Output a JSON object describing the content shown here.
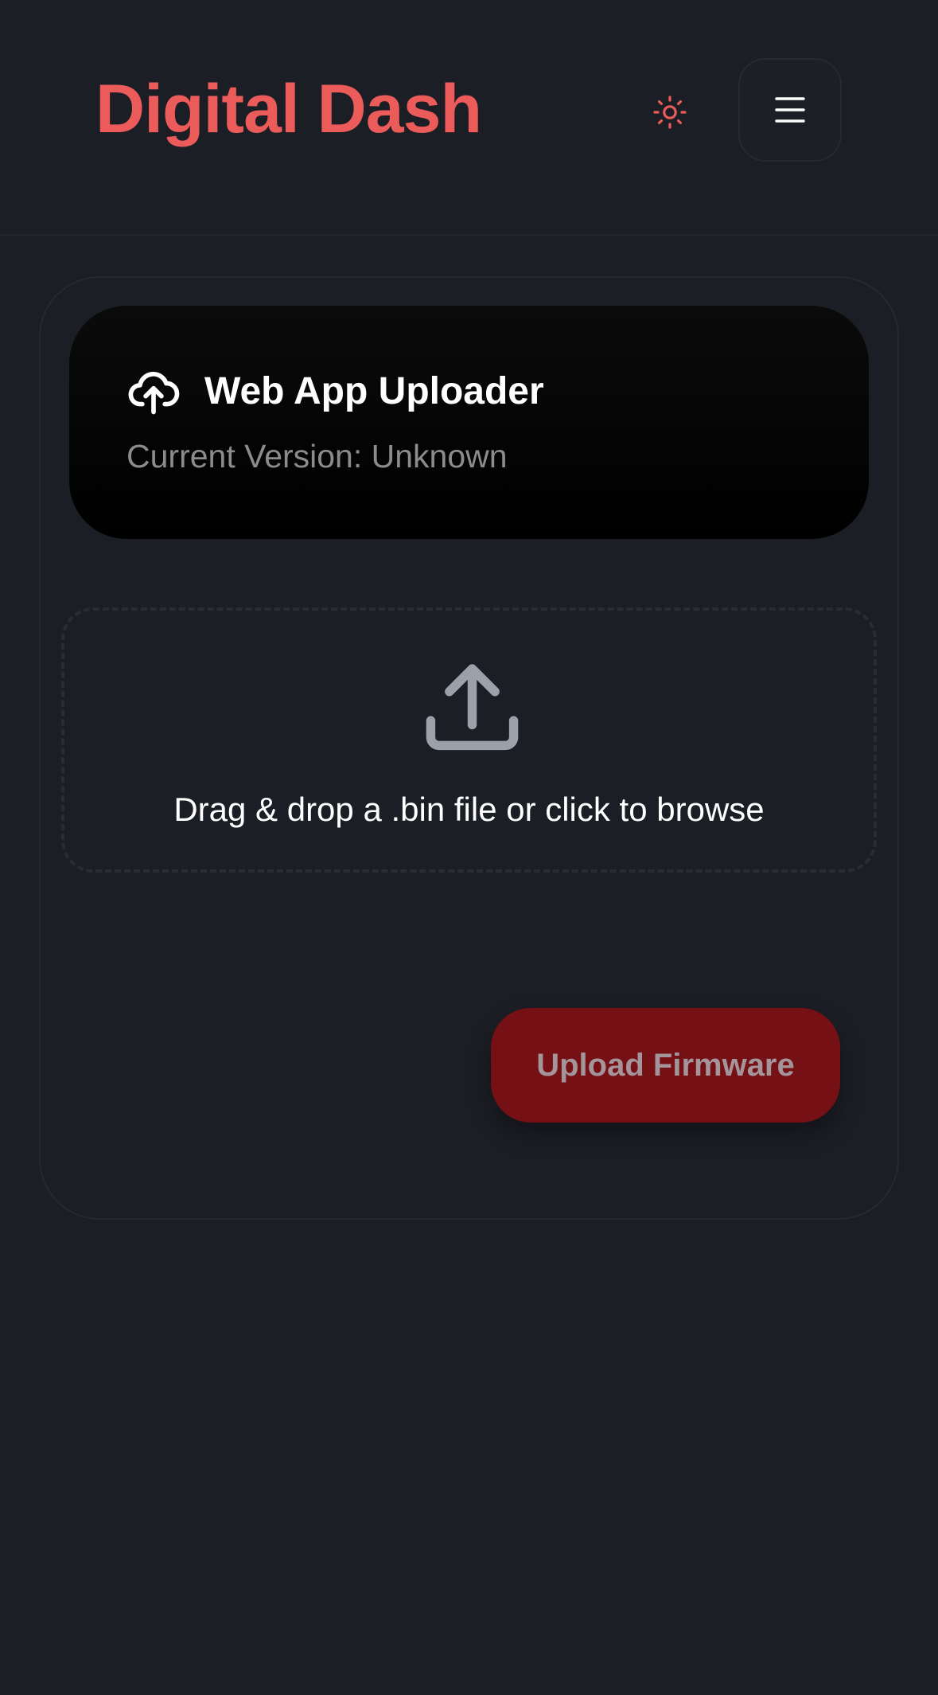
{
  "header": {
    "brand": "Digital Dash",
    "theme_icon": "sun-icon",
    "menu_icon": "hamburger-menu-icon"
  },
  "uploader": {
    "icon": "cloud-upload-icon",
    "title": "Web App Uploader",
    "version_text": "Current Version: Unknown"
  },
  "dropzone": {
    "icon": "upload-tray-icon",
    "text": "Drag & drop a .bin file or click to browse"
  },
  "actions": {
    "upload_label": "Upload Firmware",
    "upload_disabled": true
  },
  "colors": {
    "background": "#1c1e25",
    "brand": "#ea5b59",
    "panel": "#000000",
    "button": "#751015",
    "button_text": "#a3959a",
    "muted_text": "#8c8c8c",
    "icon_grey": "#9ca0ab"
  }
}
